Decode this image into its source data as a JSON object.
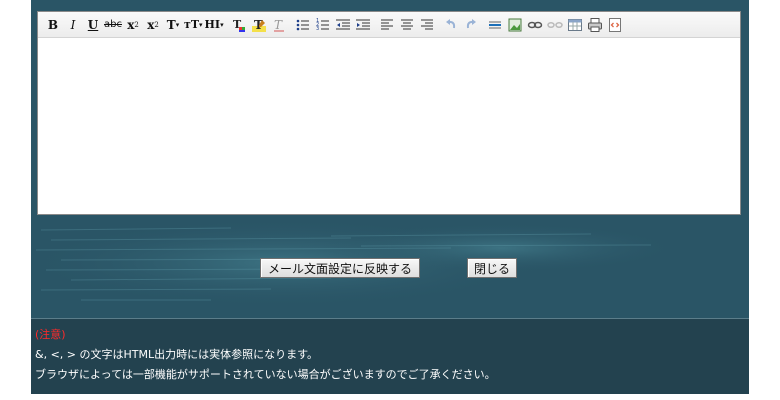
{
  "toolbar": {
    "buttons": [
      {
        "name": "bold",
        "label": "B"
      },
      {
        "name": "italic",
        "label": "I"
      },
      {
        "name": "underline",
        "label": "U"
      },
      {
        "name": "strikethrough",
        "label": "abc"
      },
      {
        "name": "subscript",
        "label": "x"
      },
      {
        "name": "superscript",
        "label": "x"
      },
      {
        "name": "font-family",
        "label": "T"
      },
      {
        "name": "font-size",
        "label": "тT"
      },
      {
        "name": "heading",
        "label": "HI"
      }
    ],
    "icons": [
      "font-color-icon",
      "highlight-color-icon",
      "remove-format-icon",
      "unordered-list-icon",
      "ordered-list-icon",
      "outdent-icon",
      "indent-icon",
      "align-left-icon",
      "align-center-icon",
      "align-right-icon",
      "undo-icon",
      "redo-icon",
      "horizontal-rule-icon",
      "insert-image-icon",
      "insert-link-icon",
      "unlink-icon",
      "insert-table-icon",
      "print-icon",
      "view-source-icon"
    ]
  },
  "editor": {
    "content": ""
  },
  "actions": {
    "apply_label": "メール文面設定に反映する",
    "close_label": "閉じる"
  },
  "notice": {
    "title": "(注意)",
    "line1": "&, <, > の文字はHTML出力時には実体参照になります。",
    "line2": "ブラウザによっては一部機能がサポートされていない場合がございますのでご了承ください。"
  },
  "colors": {
    "panel": "#2a5566",
    "notice_bg": "#23424f",
    "notice_title": "#ff2a2a"
  }
}
